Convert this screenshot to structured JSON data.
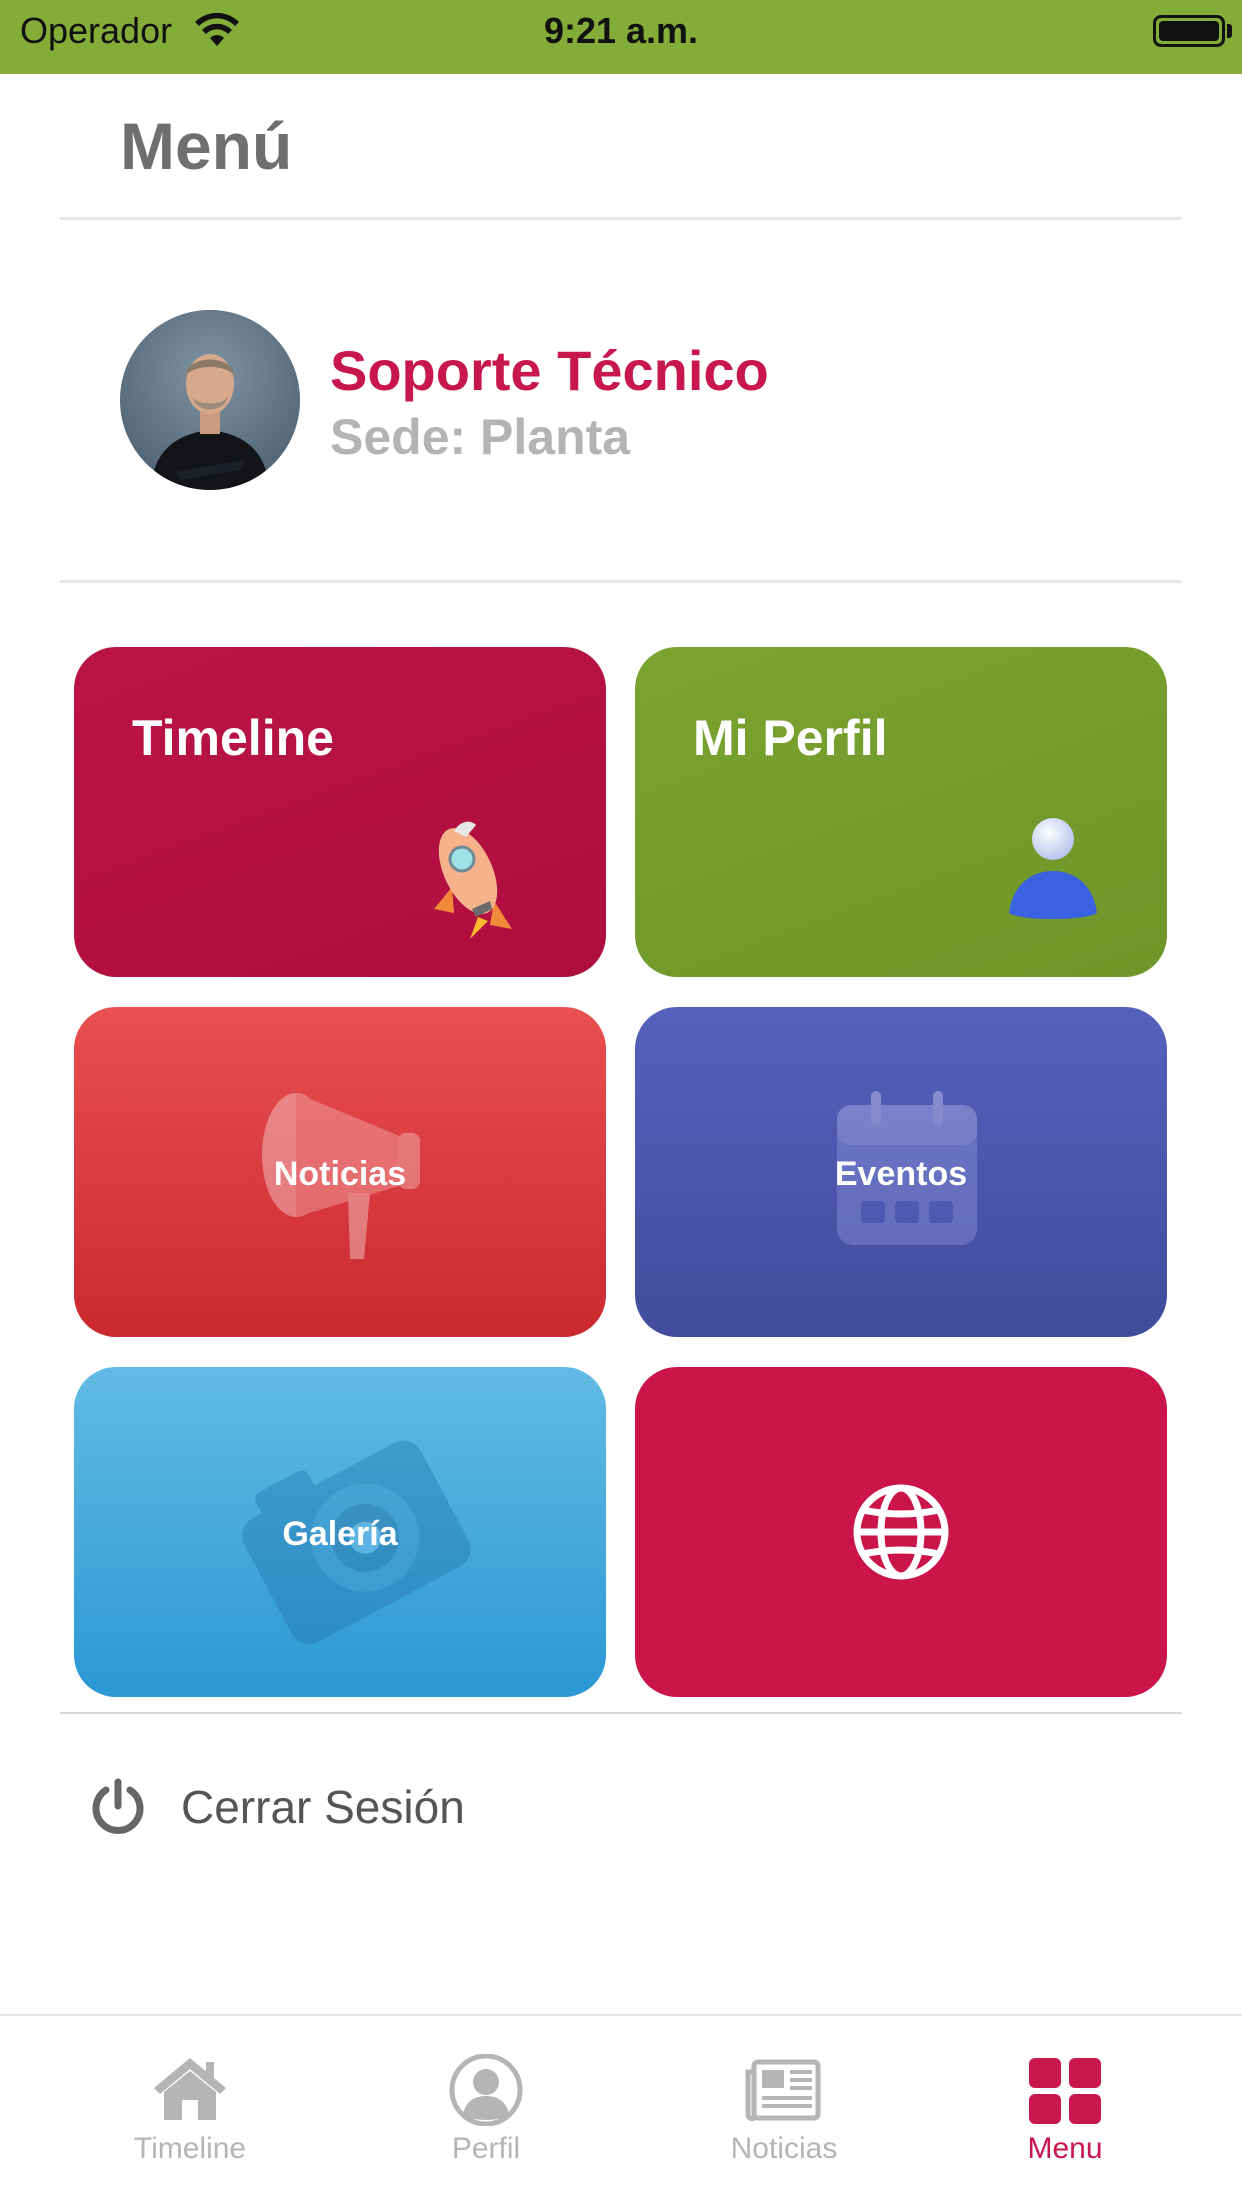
{
  "status_bar": {
    "carrier": "Operador",
    "time": "9:21 a.m.",
    "background_color": "#83ac38"
  },
  "header": {
    "title": "Menú"
  },
  "profile": {
    "name": "Soporte Técnico",
    "site": "Sede: Planta",
    "avatar_icon": "user-photo"
  },
  "tiles": [
    {
      "label": "Timeline",
      "icon": "rocket-icon",
      "color": "#b51143"
    },
    {
      "label": "Mi Perfil",
      "icon": "person-icon",
      "color": "#76a02e"
    },
    {
      "label": "Noticias",
      "icon": "megaphone-icon",
      "color": "#d83b40"
    },
    {
      "label": "Eventos",
      "icon": "calendar-icon",
      "color": "#4a55ad"
    },
    {
      "label": "Galería",
      "icon": "camera-icon",
      "color": "#46aadc"
    },
    {
      "label": "",
      "icon": "globe-icon",
      "color": "#cb154a"
    }
  ],
  "logout": {
    "label": "Cerrar Sesión",
    "icon": "power-icon"
  },
  "tab_bar": {
    "items": [
      {
        "label": "Timeline",
        "icon": "home-icon",
        "active": false
      },
      {
        "label": "Perfil",
        "icon": "user-circle-icon",
        "active": false
      },
      {
        "label": "Noticias",
        "icon": "newspaper-icon",
        "active": false
      },
      {
        "label": "Menu",
        "icon": "grid-icon",
        "active": true
      }
    ],
    "active_color": "#c8174c",
    "inactive_color": "#b5b5b5"
  }
}
